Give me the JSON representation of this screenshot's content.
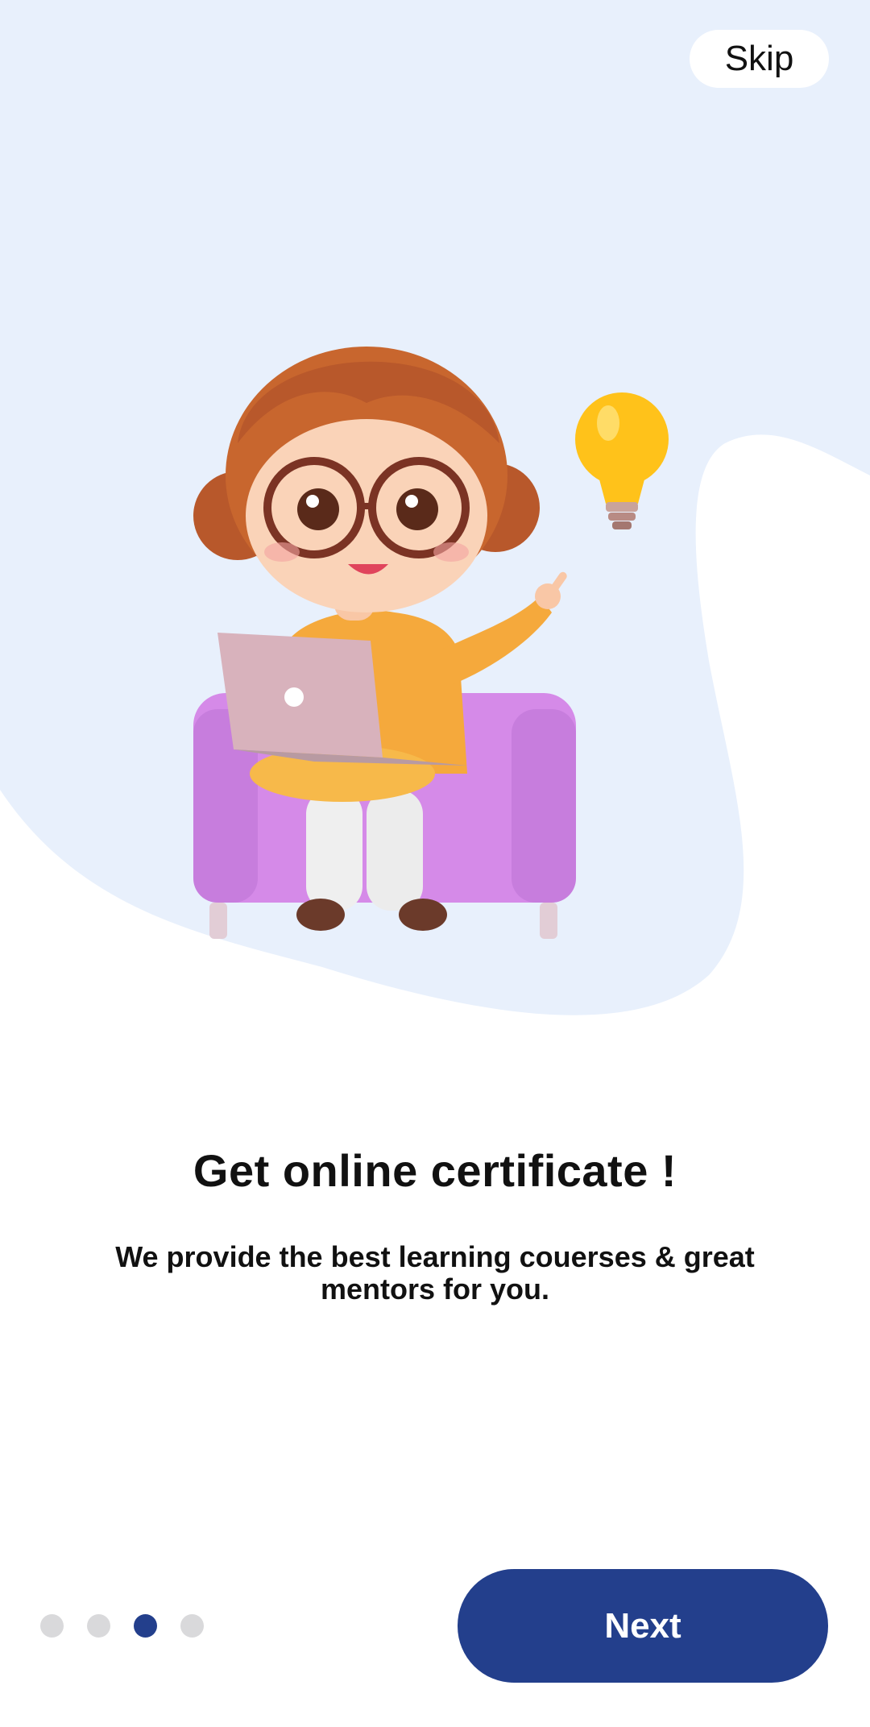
{
  "onboarding": {
    "skip_label": "Skip",
    "title": "Get online certificate !",
    "subtitle": "We provide the best  learning couerses & great mentors for you.",
    "next_label": "Next",
    "page_indicator": {
      "total": 4,
      "current": 3
    }
  },
  "colors": {
    "background_blob": "#e8f0fc",
    "accent": "#233f8c",
    "dot_inactive": "#d9d9db"
  },
  "illustration": {
    "icon": "girl-with-laptop-and-lightbulb-illustration"
  }
}
